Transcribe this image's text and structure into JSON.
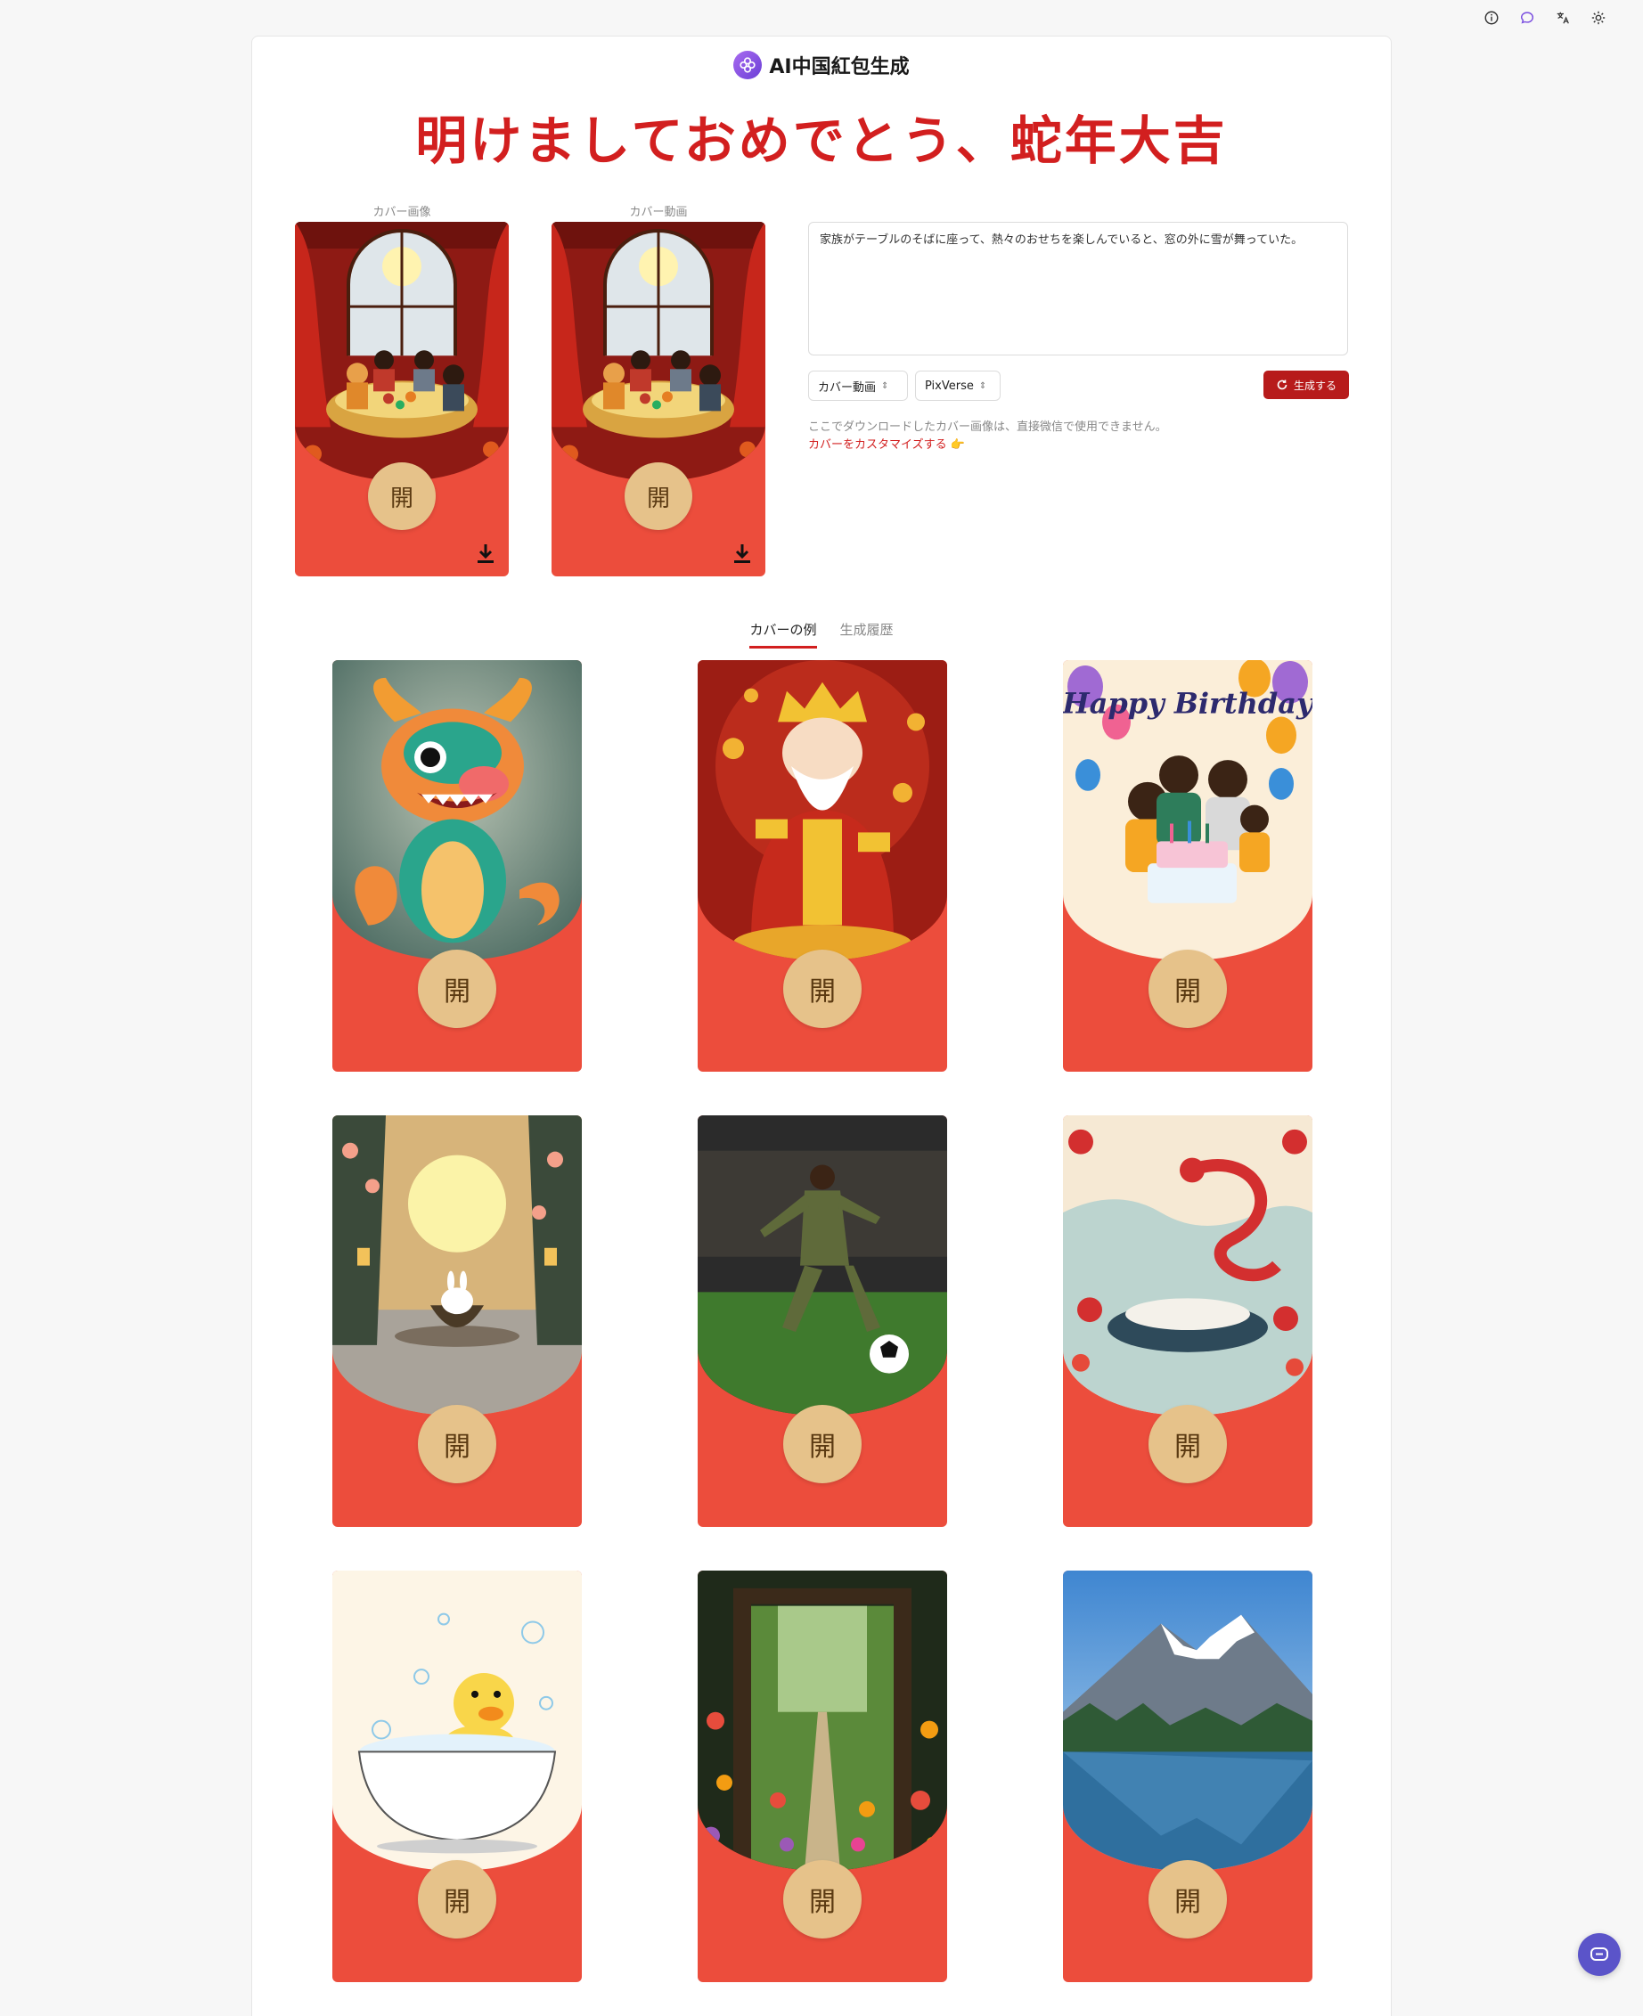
{
  "app": {
    "name": "AI中国紅包生成",
    "headline": "明けましておめでとう、蛇年大吉"
  },
  "toolbar": {
    "icons": [
      "info-icon",
      "chat-icon",
      "translate-icon",
      "settings-icon"
    ]
  },
  "preview": {
    "image_label": "カバー画像",
    "video_label": "カバー動画",
    "open_char": "開"
  },
  "generator": {
    "prompt": "家族がテーブルのそばに座って、熱々のおせちを楽しんでいると、窓の外に雪が舞っていた。",
    "mode_select": "カバー動画",
    "model_select": "PixVerse",
    "generate_label": "生成する",
    "note": "ここでダウンロードしたカバー画像は、直接微信で使用できません。",
    "customize_link": "カバーをカスタマイズする 👉"
  },
  "tabs": [
    {
      "label": "カバーの例",
      "active": true
    },
    {
      "label": "生成履歴",
      "active": false
    }
  ],
  "gallery": {
    "open_char": "開",
    "items": [
      {
        "subject": "cartoon dragon"
      },
      {
        "subject": "god of wealth"
      },
      {
        "subject": "birthday family",
        "caption": "Happy Birthday"
      },
      {
        "subject": "moon rabbit"
      },
      {
        "subject": "soccer player"
      },
      {
        "subject": "red dragon banquet"
      },
      {
        "subject": "duck in bathtub"
      },
      {
        "subject": "garden doorway"
      },
      {
        "subject": "mountain lake"
      }
    ]
  },
  "colors": {
    "headline_red": "#d21f1f",
    "envelope_red": "#ec4d3c",
    "button_red": "#b71b1b",
    "open_gold": "#e6c28a",
    "brand_purple": "#6a3fd6"
  }
}
